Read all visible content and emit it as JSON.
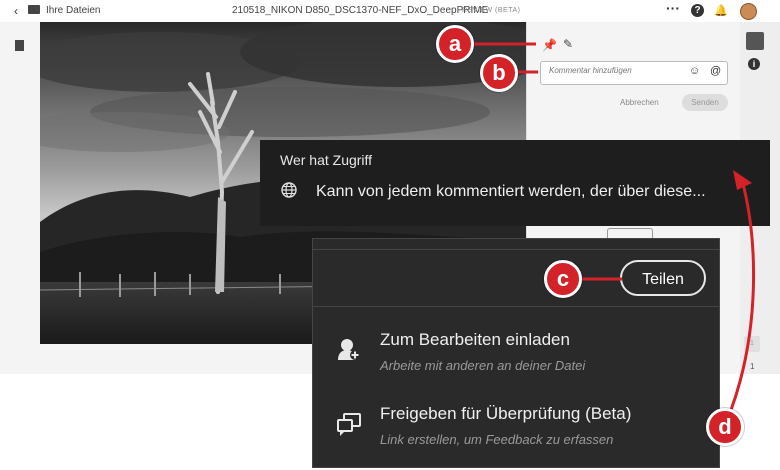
{
  "topbar": {
    "back_icon": "chevron-left-icon",
    "folder_icon": "folder-icon",
    "breadcrumb": "Ihre Dateien",
    "file_title": "210518_NIKON D850_DSC1370-NEF_DxO_DeepPRIME",
    "review_badge": "REVIEW (BETA)",
    "more_label": "···",
    "help_label": "?"
  },
  "comment_panel": {
    "placeholder": "Kommentar hinzufügen",
    "cancel_label": "Abbrechen",
    "send_label": "Senden"
  },
  "right_rail": {
    "info_label": "i"
  },
  "pagination": {
    "page_box": "1",
    "page_number": "1"
  },
  "access_popup": {
    "heading": "Wer hat Zugriff",
    "text": "Kann von jedem kommentiert werden, der über diese..."
  },
  "share_popup": {
    "share_button": "Teilen",
    "options": [
      {
        "title": "Zum Bearbeiten einladen",
        "subtitle": "Arbeite mit anderen an deiner Datei",
        "icon": "invite-user-icon"
      },
      {
        "title": "Freigeben für Überprüfung (Beta)",
        "subtitle": "Link erstellen, um Feedback zu erfassen",
        "icon": "review-comments-icon"
      }
    ]
  },
  "callouts": {
    "a": "a",
    "b": "b",
    "c": "c",
    "d": "d"
  },
  "colors": {
    "callout_red": "#d32228",
    "popup_dark": "#1e1e1e",
    "share_dark": "#2a2a2a"
  }
}
